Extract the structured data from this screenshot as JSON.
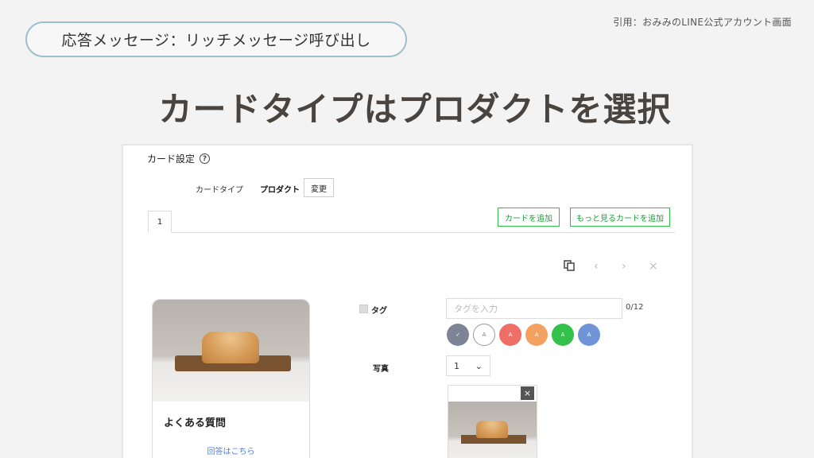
{
  "citation": "引用：おみみのLINE公式アカウント画面",
  "pill_title": "応答メッセージ：リッチメッセージ呼び出し",
  "headline": "カードタイプはプロダクトを選択",
  "panel": {
    "title": "カード設定",
    "help_icon": "?",
    "card_type_label": "カードタイプ",
    "card_type_value": "プロダクト",
    "change_button": "変更",
    "tab_label": "1",
    "add_card_button": "カードを追加",
    "add_more_button": "もっと見るカードを追加"
  },
  "toolbar": {
    "copy_icon": "copy-icon",
    "prev_icon": "‹",
    "next_icon": "›",
    "close_icon": "×"
  },
  "preview": {
    "title": "よくある質問",
    "link": "回答はこちら"
  },
  "form": {
    "tag_label": "タグ",
    "tag_placeholder": "タグを入力",
    "tag_count": "0/12",
    "color_options": [
      {
        "label": "✓",
        "color": "#7d8496"
      },
      {
        "label": "A",
        "color": "#ffffff"
      },
      {
        "label": "A",
        "color": "#ef6f67"
      },
      {
        "label": "A",
        "color": "#f2a161"
      },
      {
        "label": "A",
        "color": "#33c14b"
      },
      {
        "label": "A",
        "color": "#6f95d8"
      }
    ],
    "photo_label": "写真",
    "photo_count_value": "1",
    "chevron_icon": "⌄",
    "remove_photo_icon": "×"
  }
}
